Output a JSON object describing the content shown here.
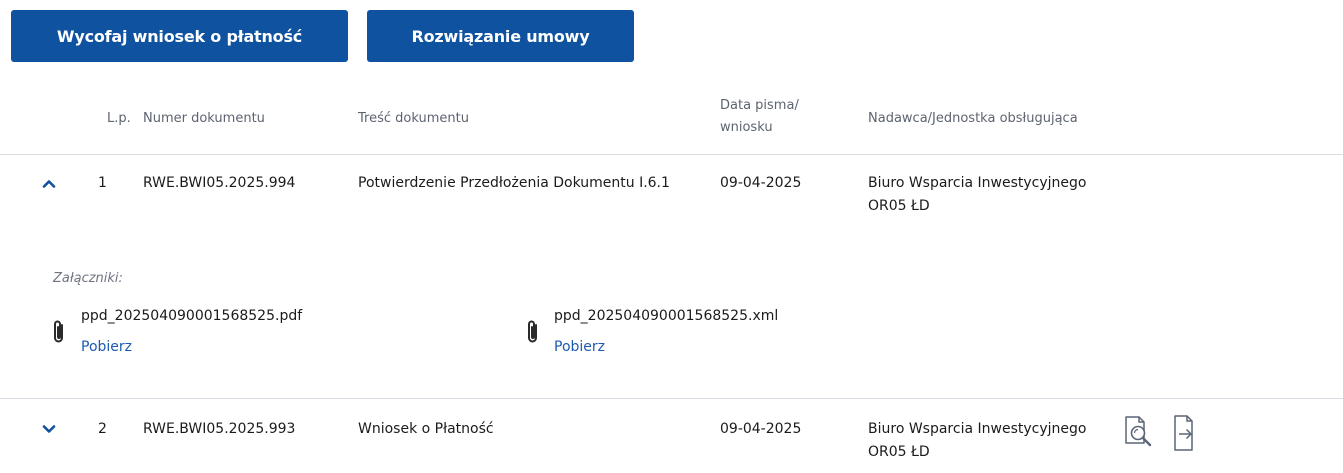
{
  "actions": {
    "withdraw_label": "Wycofaj wniosek o płatność",
    "terminate_label": "Rozwiązanie umowy"
  },
  "table": {
    "headers": {
      "lp": "L.p.",
      "number": "Numer dokumentu",
      "content": "Treść dokumentu",
      "date_line1": "Data pisma/",
      "date_line2": "wniosku",
      "sender": "Nadawca/Jednostka obsługująca"
    },
    "rows": [
      {
        "expanded": true,
        "lp": "1",
        "number": "RWE.BWI05.2025.994",
        "content": "Potwierdzenie Przedłożenia Dokumentu I.6.1",
        "date": "09-04-2025",
        "sender_line1": "Biuro Wsparcia Inwestycyjnego",
        "sender_line2": "OR05 ŁD",
        "attachments_label": "Załączniki:",
        "attachments": [
          {
            "name": "ppd_202504090001568525.pdf",
            "link": "Pobierz",
            "icon": "paperclip-icon"
          },
          {
            "name": "ppd_202504090001568525.xml",
            "link": "Pobierz",
            "icon": "paperclip-icon"
          }
        ]
      },
      {
        "expanded": false,
        "lp": "2",
        "number": "RWE.BWI05.2025.993",
        "content": "Wniosek o Płatność",
        "date": "09-04-2025",
        "sender_line1": "Biuro Wsparcia Inwestycyjnego",
        "sender_line2": "OR05 ŁD",
        "row_actions": [
          "document-search-icon",
          "document-export-icon"
        ]
      }
    ]
  },
  "colors": {
    "primary": "#0f52a0",
    "link": "#1a5bb0",
    "divider": "#d9dde3"
  }
}
